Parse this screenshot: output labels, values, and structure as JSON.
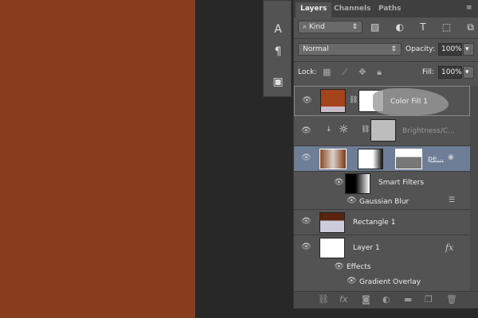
{
  "panel": {
    "tabs": [
      "Layers",
      "Channels",
      "Paths"
    ],
    "filter_kind": "Kind",
    "blend_mode": "Normal",
    "opacity_label": "Opacity:",
    "opacity": "100%",
    "lock_label": "Lock:",
    "fill_label": "Fill:",
    "fill": "100%"
  },
  "layers": [
    {
      "name": "Color Fill 1",
      "type": "fill",
      "color": "#a5431d"
    },
    {
      "name": "Brightness/C...",
      "type": "adjustment"
    },
    {
      "name": "pe...",
      "type": "smart-object",
      "selected": true
    },
    {
      "name": "Smart Filters",
      "type": "smart-filters"
    },
    {
      "name": "Gaussian Blur",
      "type": "filter"
    },
    {
      "name": "Rectangle 1",
      "type": "shape"
    },
    {
      "name": "Layer 1",
      "type": "pixel",
      "fx": "fx"
    },
    {
      "name": "Effects",
      "type": "effects"
    },
    {
      "name": "Gradient Overlay",
      "type": "effect"
    }
  ],
  "canvas_color": "#8a3d1c"
}
